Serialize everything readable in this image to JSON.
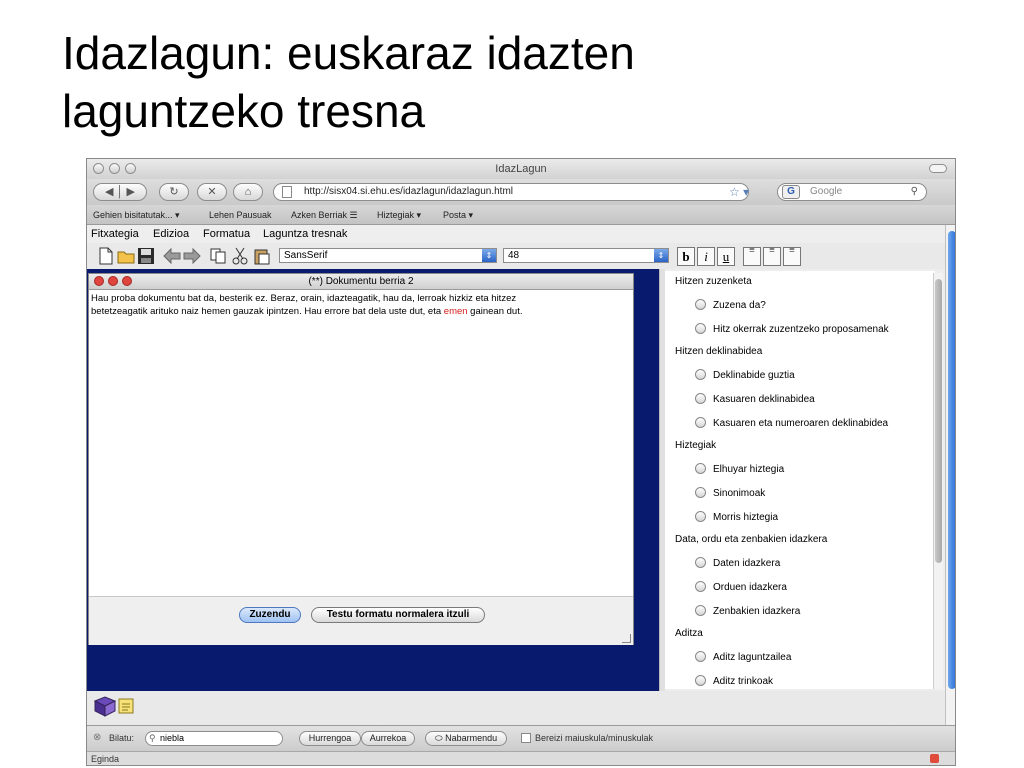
{
  "slide": {
    "title_line1": "Idazlagun: euskaraz idazten",
    "title_line2": "laguntzeko tresna"
  },
  "browser": {
    "window_title": "IdazLagun",
    "url": "http://sisx04.si.ehu.es/idazlagun/idazlagun.html",
    "search_placeholder": "Google",
    "bookmarks": [
      "Gehien bisitatutak... ▾",
      "Lehen Pausuak",
      "Azken Berriak ☰",
      "Hiztegiak ▾",
      "Posta ▾"
    ]
  },
  "app": {
    "menu": [
      "Fitxategia",
      "Edizioa",
      "Formatua",
      "Laguntza tresnak"
    ],
    "font_name": "SansSerif",
    "font_size": "48",
    "format_buttons": [
      "b",
      "i",
      "u"
    ]
  },
  "document": {
    "title": "(**)  Dokumentu berria 2",
    "text_line1": "Hau proba dokumentu bat da, besterik ez. Beraz, orain, idazteagatik, hau da, lerroak hizkiz eta hitzez",
    "text_line2_pre": "betetzeagatik arituko naiz hemen gauzak ipintzen.  Hau errore bat dela uste dut, eta ",
    "text_error": "emen",
    "text_line2_post": " gainean dut.",
    "buttons": {
      "correct": "Zuzendu",
      "normal_format": "Testu formatu normalera itzuli"
    }
  },
  "panel": {
    "sections": [
      {
        "title": "Hitzen zuzenketa",
        "options": [
          "Zuzena da?",
          "Hitz okerrak zuzentzeko proposamenak"
        ]
      },
      {
        "title": "Hitzen deklinabidea",
        "options": [
          "Deklinabide guztia",
          "Kasuaren deklinabidea",
          "Kasuaren eta numeroaren deklinabidea"
        ]
      },
      {
        "title": "Hiztegiak",
        "options": [
          "Elhuyar hiztegia",
          "Sinonimoak",
          "Morris hiztegia"
        ]
      },
      {
        "title": "Data, ordu eta zenbakien idazkera",
        "options": [
          "Daten idazkera",
          "Orduen idazkera",
          "Zenbakien idazkera"
        ]
      },
      {
        "title": "Aditza",
        "options": [
          "Aditz laguntzailea",
          "Aditz trinkoak"
        ]
      }
    ]
  },
  "findbar": {
    "label": "Bilatu:",
    "query": "niebla",
    "next": "Hurrengoa",
    "previous": "Aurrekoa",
    "highlight": "Nabarmendu",
    "match_case": "Bereizi maiuskula/minuskulak"
  },
  "status": "Eginda",
  "colors": {
    "desktop": "#081a6e",
    "error_word": "#d42020",
    "scroll_accent": "#2b6fd6"
  }
}
